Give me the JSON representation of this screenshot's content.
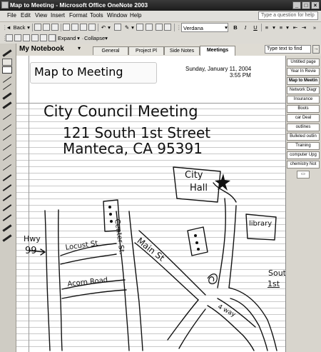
{
  "window": {
    "title": "Map to Meeting - Microsoft Office OneNote 2003"
  },
  "menu": {
    "items": [
      "File",
      "Edit",
      "View",
      "Insert",
      "Format",
      "Tools",
      "Window",
      "Help"
    ],
    "help_placeholder": "Type a question for help"
  },
  "toolbar1": {
    "back_label": "Back",
    "font": "Verdana",
    "bold": "B",
    "italic": "I",
    "underline": "U"
  },
  "toolbar2": {
    "expand_label": "Expand",
    "collapse_label": "Collapse"
  },
  "notebook": {
    "title": "My Notebook"
  },
  "sections": [
    "General",
    "Project Pl",
    "Side Notes",
    "Meetings"
  ],
  "active_section": "Meetings",
  "find": {
    "placeholder": "Type text to find"
  },
  "page": {
    "title": "Map to Meeting",
    "date": "Sunday, January 11, 2004",
    "time": "3:55 PM",
    "ink": {
      "line1": "City Council Meeting",
      "line2": "121 South 1st Street",
      "line3": "Manteca, CA 95391",
      "city_hall": [
        "City",
        "Hall"
      ],
      "library": "library",
      "hwy": [
        "Hwy",
        "99"
      ],
      "locust": "Locust St",
      "center": "Center St.",
      "main": "Main St",
      "acorn": "Acorn Road",
      "south": [
        "South",
        "1st"
      ],
      "fourway": "4 way"
    }
  },
  "page_tabs": [
    "Untitled page",
    "Year In Revie",
    "Map to Meetin",
    "Network Diagr",
    "Insurance",
    "Boots",
    "car Deal",
    "outlines",
    "Bulleted outlin",
    "Training",
    "computer Upg",
    "chemistry Not"
  ],
  "active_page_tab": "Map to Meetin"
}
